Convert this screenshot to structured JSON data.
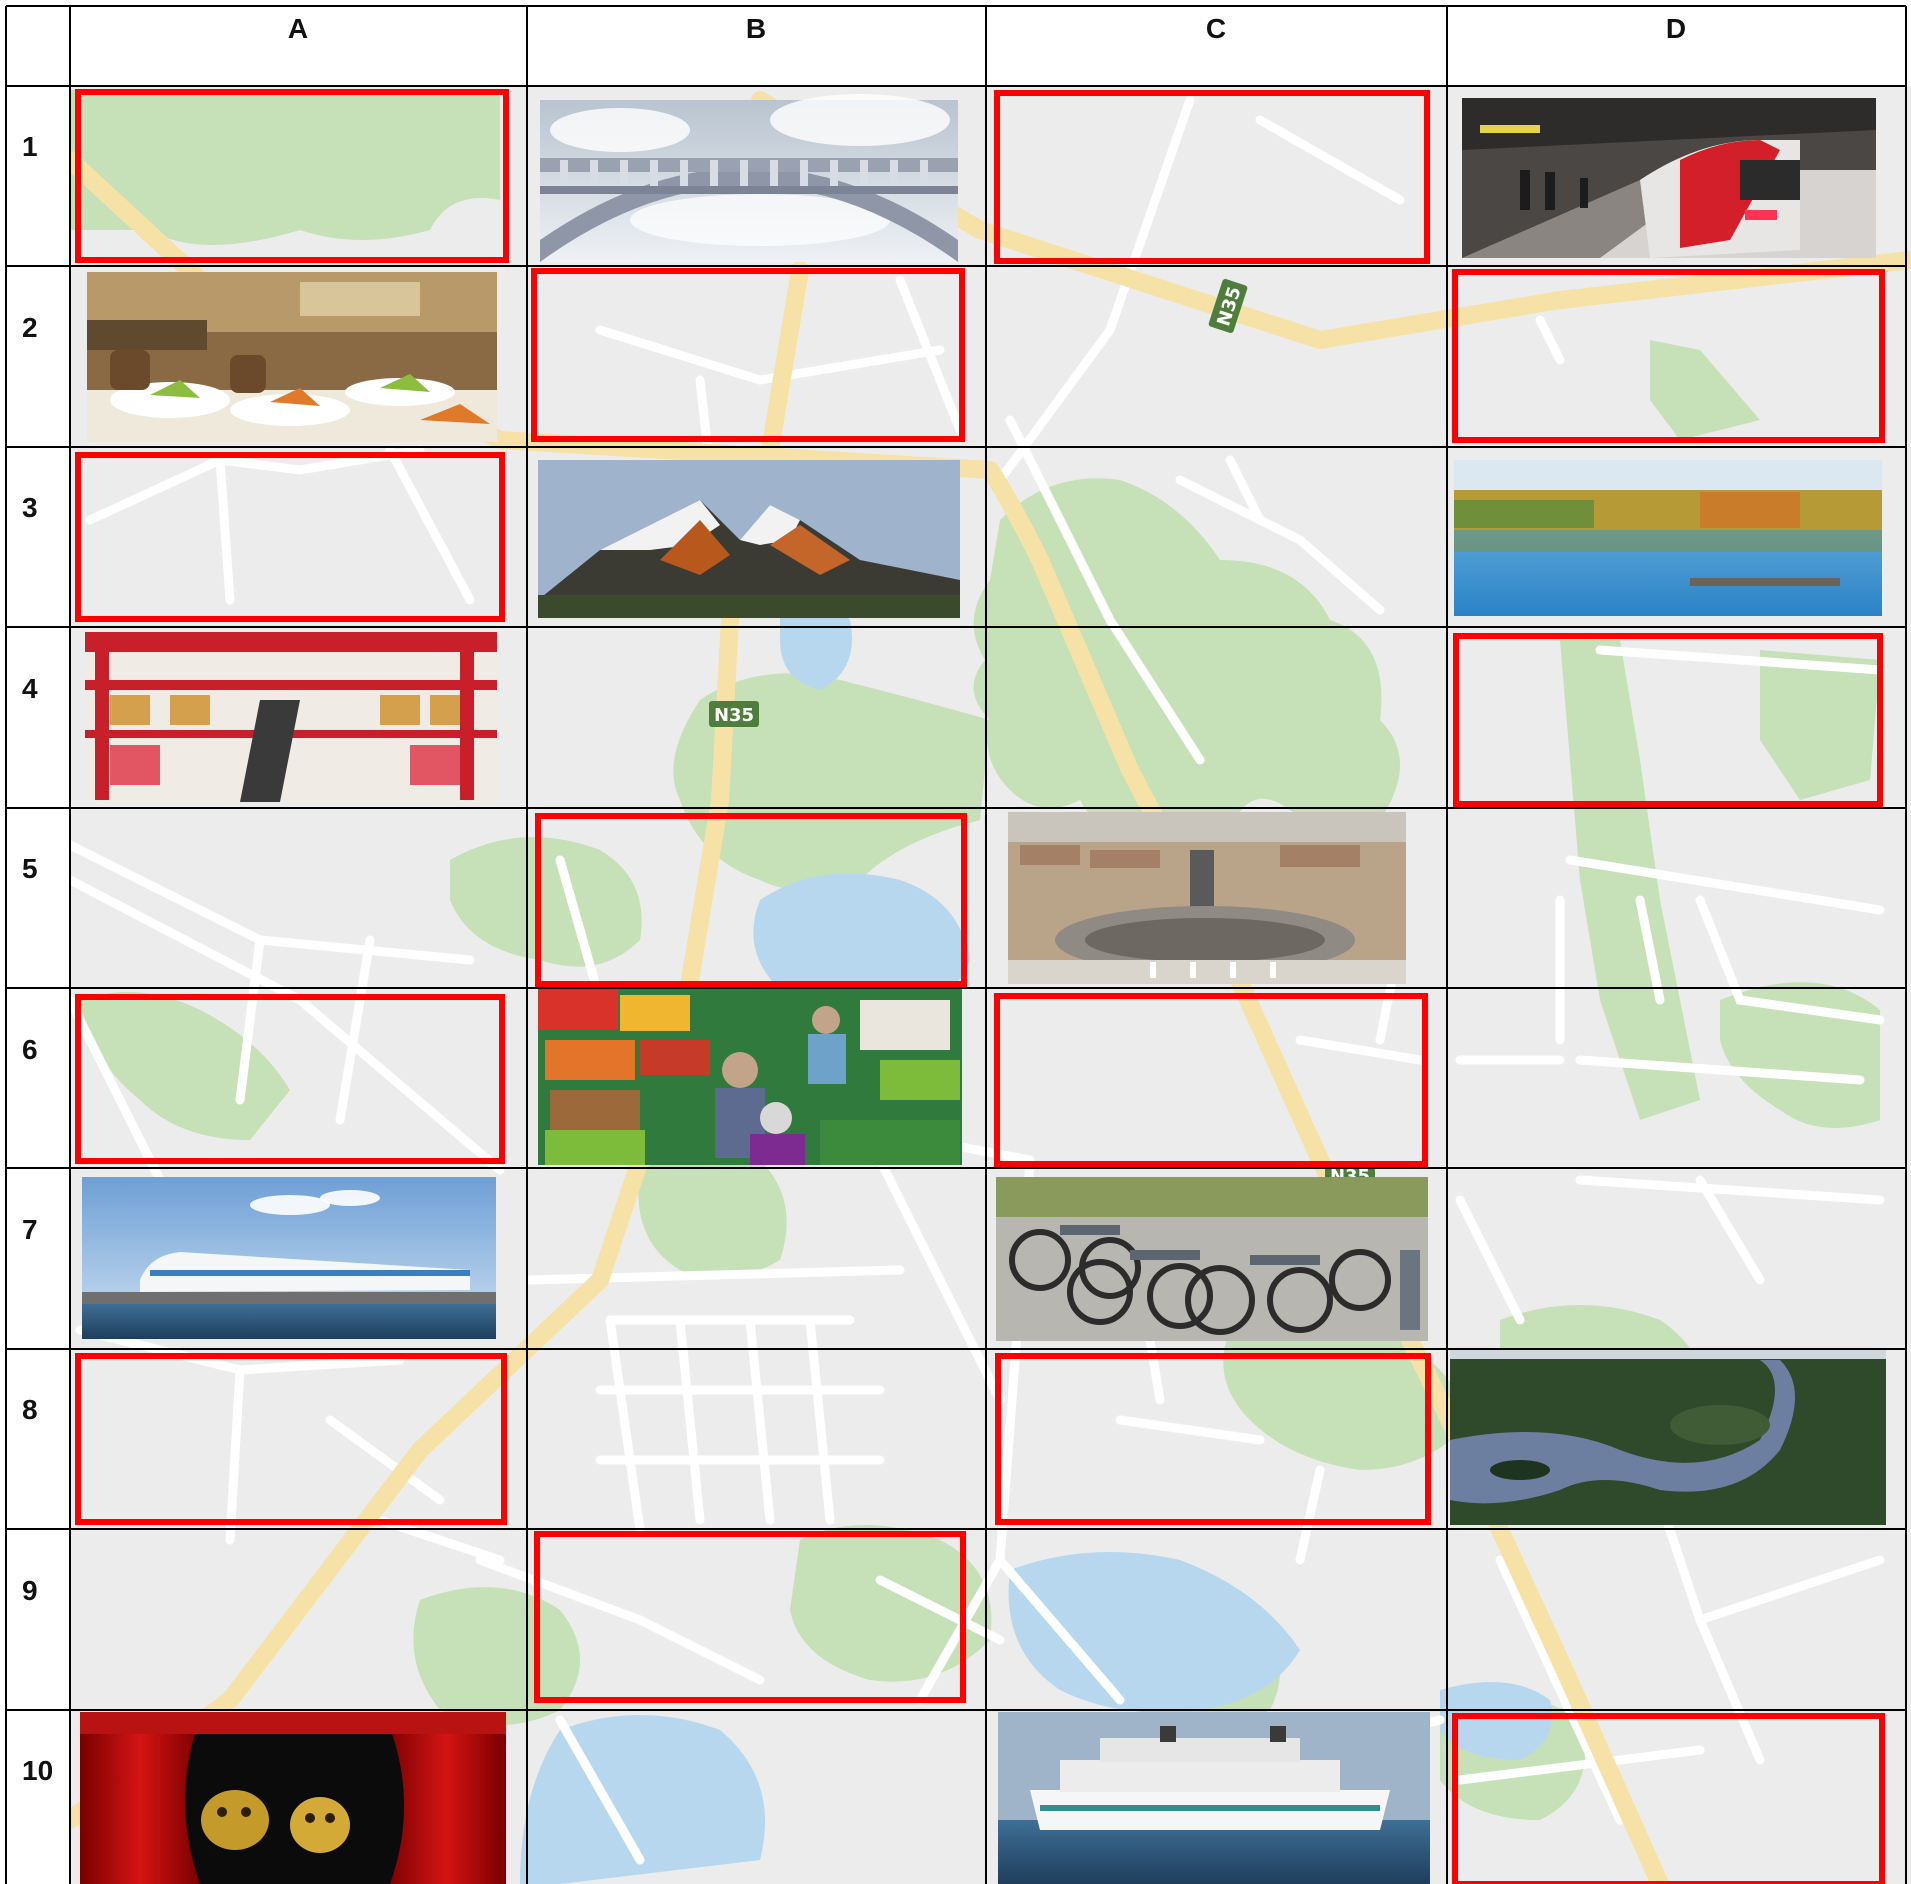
{
  "column_headers": [
    "A",
    "B",
    "C",
    "D"
  ],
  "row_headers": [
    "1",
    "2",
    "3",
    "4",
    "5",
    "6",
    "7",
    "8",
    "9",
    "10"
  ],
  "road_labels": [
    "N35",
    "N35",
    "N35"
  ],
  "photo_cells": [
    {
      "cell": "B1",
      "subject": "stone arch bridge in the clouds"
    },
    {
      "cell": "D1",
      "subject": "metro train at underground station"
    },
    {
      "cell": "A2",
      "subject": "restaurant dining room"
    },
    {
      "cell": "B3",
      "subject": "snow-capped mountain peaks"
    },
    {
      "cell": "D3",
      "subject": "lake with autumn forest and jetty"
    },
    {
      "cell": "A4",
      "subject": "multi-storey shopping mall"
    },
    {
      "cell": "C5",
      "subject": "aerial view of St. Peter's Square"
    },
    {
      "cell": "B6",
      "subject": "fruit and vegetable market"
    },
    {
      "cell": "A7",
      "subject": "high-speed maglev train"
    },
    {
      "cell": "C7",
      "subject": "public bike sharing station"
    },
    {
      "cell": "D8",
      "subject": "aerial view of river through rainforest"
    },
    {
      "cell": "A10",
      "subject": "theatre stage with red curtains and masks"
    },
    {
      "cell": "C10",
      "subject": "passenger ferry at sea"
    }
  ],
  "highlighted_cells": [
    "A1",
    "C1",
    "B2",
    "D2",
    "A3",
    "D4",
    "B5",
    "A6",
    "C6",
    "A8",
    "C8",
    "B9",
    "D10"
  ],
  "colors": {
    "map_background": "#ececec",
    "park": "#c6e0b8",
    "water": "#b7d7ef",
    "main_road": "#f6e2a6",
    "street": "#ffffff",
    "highlight": "#ff0000",
    "grid": "#000000",
    "road_shield": "#4e7d3c"
  }
}
